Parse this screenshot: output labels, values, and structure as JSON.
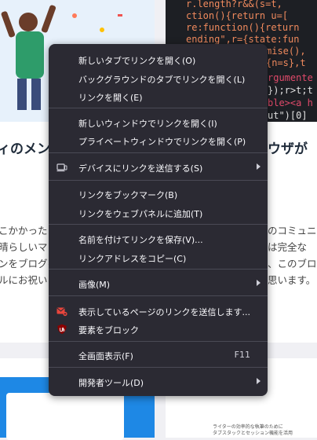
{
  "background": {
    "left_title": "ィのメン",
    "right_title": "ウザが",
    "left_body": [
      "こかかった",
      "晴らしいマ",
      "ンをブログを",
      "ルにお祝い"
    ],
    "right_body": [
      "のコミュニ",
      "は完全な",
      "、このブロ",
      "思います。"
    ],
    "code": [
      "r.length?r&&(s=t,",
      "ction(){return u=[",
      "re:function(){return",
      "ending\",r={state:fun",
      "mise(),",
      "{n=s},t",
      "rgumente",
      "});r>t;t",
      "ble><a h",
      "ut\")[0]"
    ],
    "bottom_right_text": [
      "ライターの効率的な執筆のために",
      "タブスタックとセッション機能を活用"
    ]
  },
  "menu": {
    "items": [
      {
        "label": "新しいタブでリンクを開く(O)"
      },
      {
        "label": "バックグラウンドのタブでリンクを開く(L)"
      },
      {
        "label": "リンクを開く(E)"
      },
      {
        "label": "新しいウィンドウでリンクを開く(I)"
      },
      {
        "label": "プライベートウィンドウでリンクを開く(P)"
      },
      {
        "label": "デバイスにリンクを送信する(S)"
      },
      {
        "label": "リンクをブックマーク(B)"
      },
      {
        "label": "リンクをウェブパネルに追加(T)"
      },
      {
        "label": "名前を付けてリンクを保存(V)..."
      },
      {
        "label": "リンクアドレスをコピー(C)"
      },
      {
        "label": "画像(M)"
      },
      {
        "label": "表示しているページのリンクを送信します..."
      },
      {
        "label": "要素をブロック"
      },
      {
        "label": "全画面表示(F)",
        "accel": "F11"
      },
      {
        "label": "開発者ツール(D)"
      }
    ]
  },
  "colors": {
    "menu_bg": "#2b2a33",
    "menu_text": "#fbfbfe",
    "separator": "#4a4a55",
    "mail_icon": "#e8453c",
    "ublock_icon": "#8b0000"
  }
}
